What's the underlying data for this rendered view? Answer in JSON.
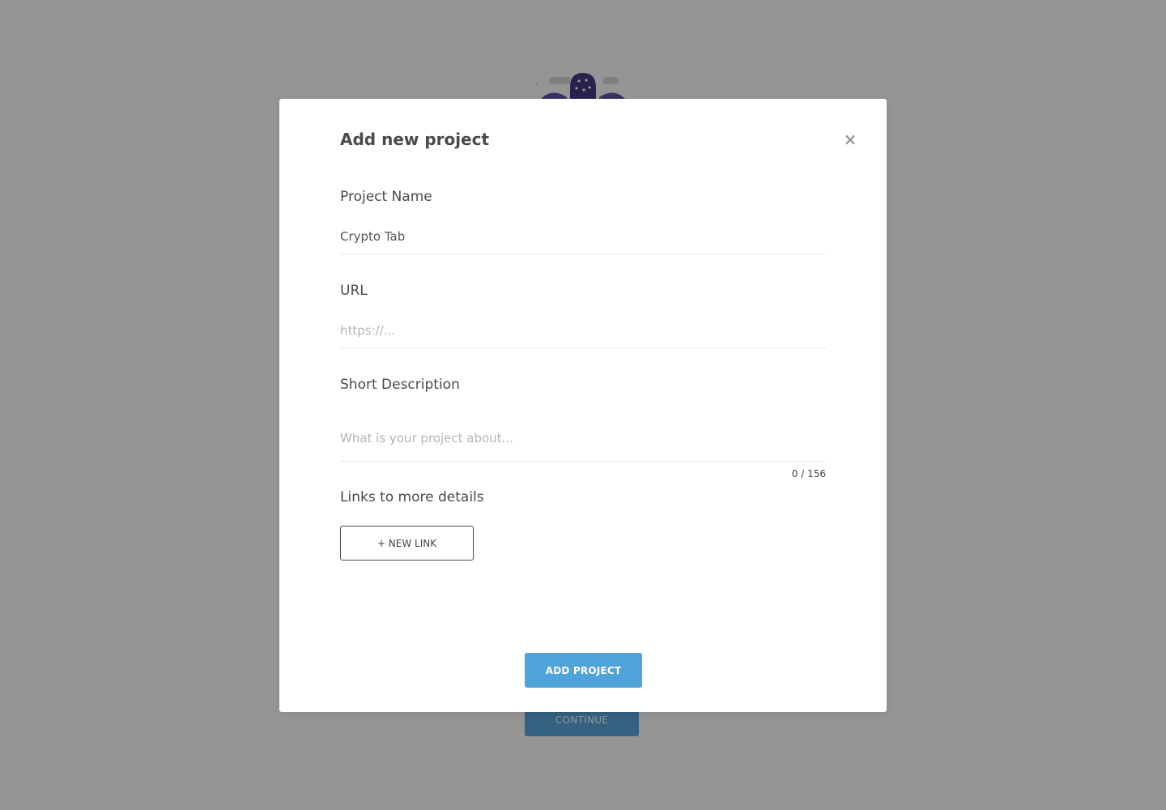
{
  "background": {
    "continue_label": "CONTINUE",
    "mascot_icon": "octopus-mascot-icon"
  },
  "modal": {
    "title": "Add new project",
    "close_icon": "close-icon",
    "close_glyph": "×",
    "fields": {
      "project_name": {
        "label": "Project Name",
        "value": "Crypto Tab",
        "placeholder": ""
      },
      "url": {
        "label": "URL",
        "value": "",
        "placeholder": "https://..."
      },
      "short_description": {
        "label": "Short Description",
        "value": "",
        "placeholder": "What is your project about...",
        "counter": "0 / 156"
      }
    },
    "links": {
      "label": "Links to more details",
      "new_link_button": "+ NEW LINK"
    },
    "submit_label": "ADD PROJECT"
  },
  "colors": {
    "accent": "#4fa3d9",
    "overlay": "#939393",
    "modal_background": "#ffffff",
    "text": "#4a4a4a",
    "mascot": "#3c2f7e"
  }
}
